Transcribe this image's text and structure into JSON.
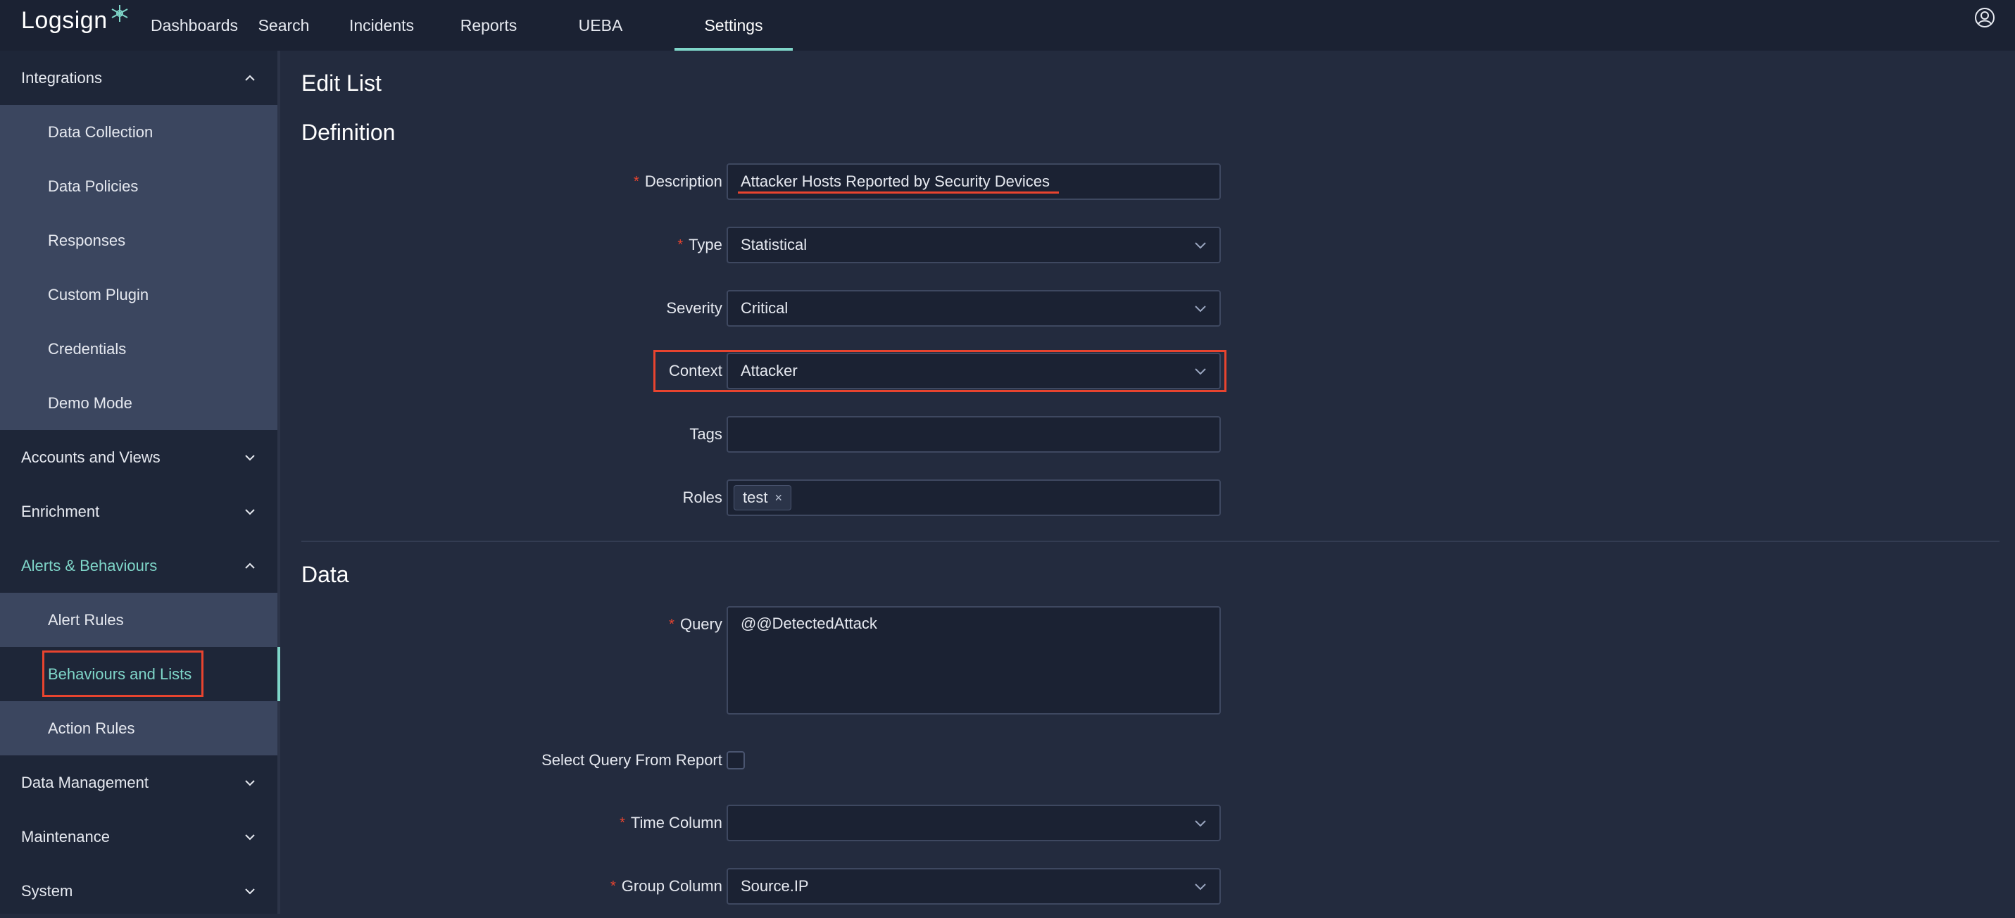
{
  "app": {
    "logo_text": "Logsign"
  },
  "nav": {
    "items": [
      "Dashboards",
      "Search",
      "Incidents",
      "Reports",
      "UEBA",
      "Settings"
    ],
    "active": "Settings"
  },
  "sidebar": {
    "integrations": {
      "label": "Integrations",
      "items": [
        "Data Collection",
        "Data Policies",
        "Responses",
        "Custom Plugin",
        "Credentials",
        "Demo Mode"
      ]
    },
    "accounts_views": "Accounts and Views",
    "enrichment": "Enrichment",
    "alerts": {
      "label": "Alerts & Behaviours",
      "items": [
        "Alert Rules",
        "Behaviours and Lists",
        "Action Rules"
      ]
    },
    "data_management": "Data Management",
    "maintenance": "Maintenance",
    "system": "System"
  },
  "main": {
    "page_title": "Edit List",
    "definition_title": "Definition",
    "data_title": "Data",
    "form": {
      "description": {
        "label": "Description",
        "value": "Attacker Hosts Reported by Security Devices"
      },
      "type": {
        "label": "Type",
        "value": "Statistical"
      },
      "severity": {
        "label": "Severity",
        "value": "Critical"
      },
      "context": {
        "label": "Context",
        "value": "Attacker"
      },
      "tags": {
        "label": "Tags",
        "value": ""
      },
      "roles": {
        "label": "Roles",
        "tag": "test",
        "tag_remove": "×"
      },
      "query": {
        "label": "Query",
        "value": "@@DetectedAttack"
      },
      "select_query": {
        "label": "Select Query From Report"
      },
      "time_column": {
        "label": "Time Column",
        "value": ""
      },
      "group_column": {
        "label": "Group Column",
        "value": "Source.IP"
      }
    },
    "required_mark": "*",
    "colon": ":"
  },
  "colors": {
    "accent": "#7fd6c9",
    "highlight": "#e8442f",
    "background": "#232b3e"
  }
}
